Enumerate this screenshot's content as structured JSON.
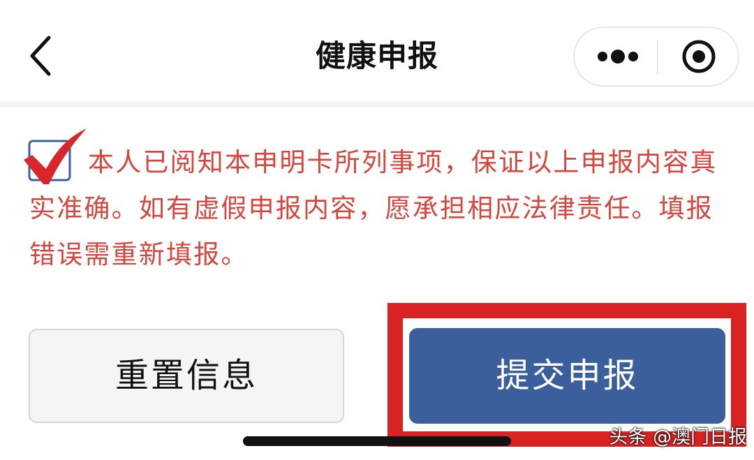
{
  "header": {
    "title": "健康申报",
    "back_icon": "chevron-left-icon",
    "more_icon": "more-dots-icon",
    "close_icon": "record-close-icon"
  },
  "declaration": {
    "checked": true,
    "check_color": "#d8262b",
    "text": "本人已阅知本申明卡所列事项，保证以上申报内容真实准确。如有虚假申报内容，愿承担相应法律责任。填报错误需重新填报。",
    "text_color": "#d8453d"
  },
  "actions": {
    "reset_label": "重置信息",
    "submit_label": "提交申报",
    "submit_color": "#3b5f9d",
    "highlight_color": "#d92323"
  },
  "watermark": {
    "text": "头条 @澳门日报"
  }
}
